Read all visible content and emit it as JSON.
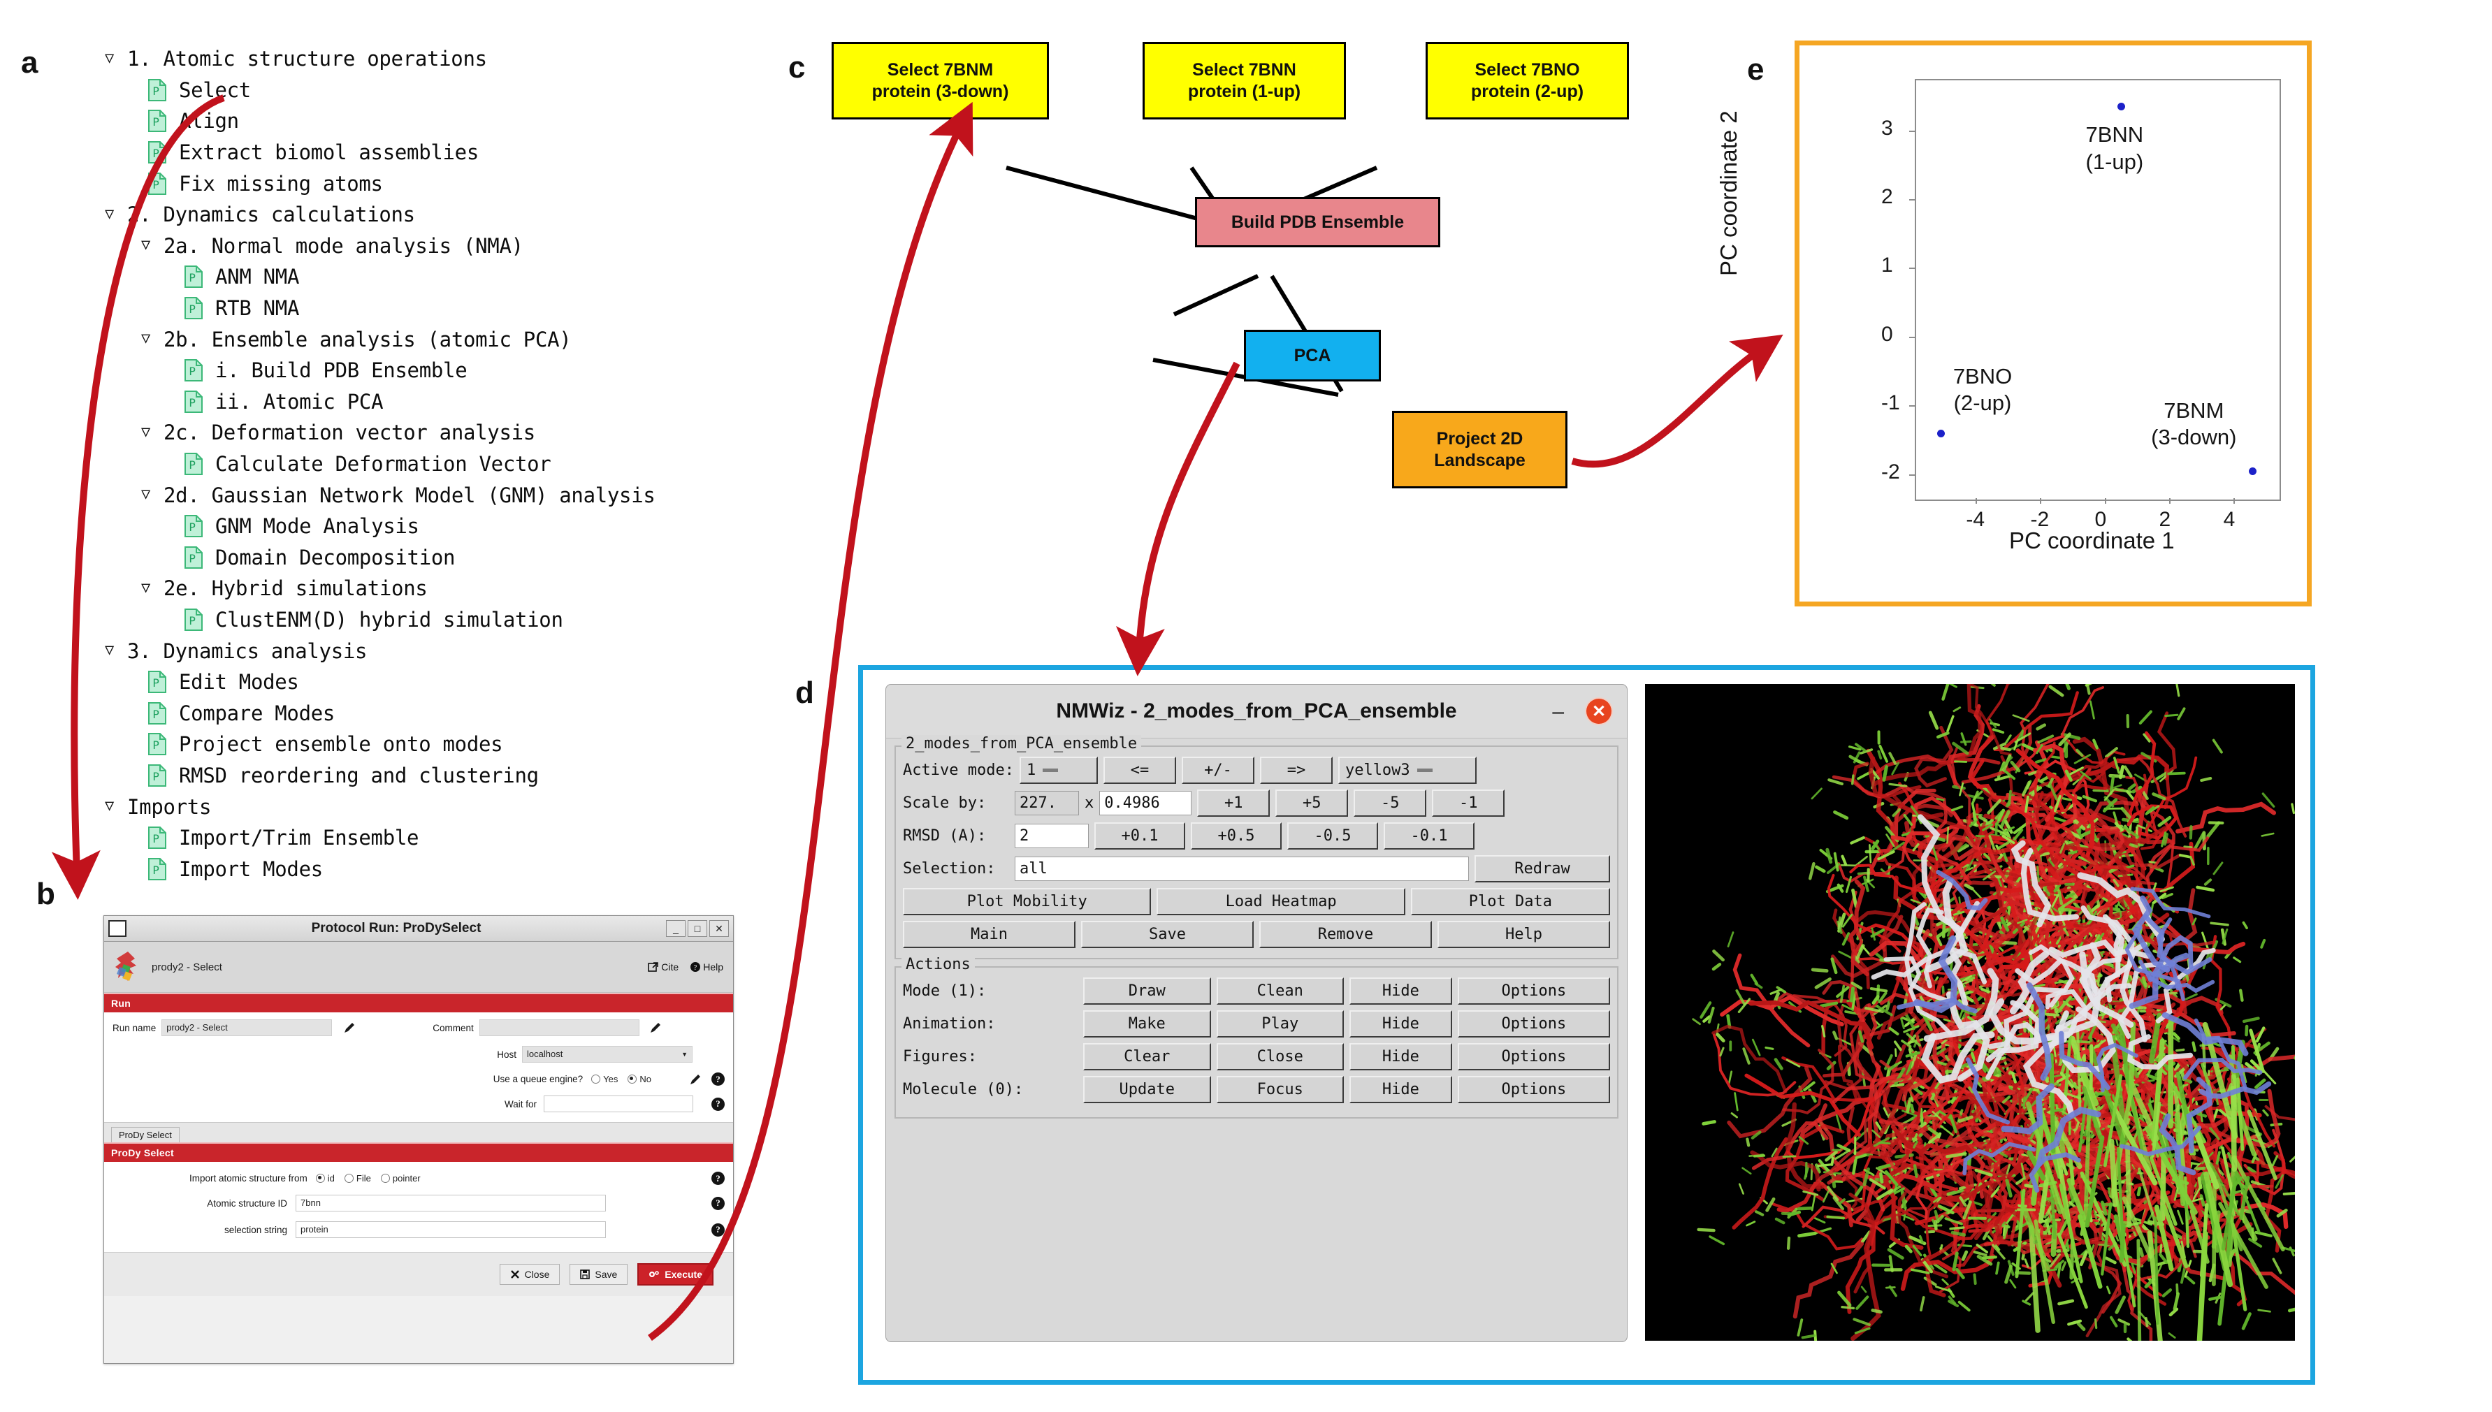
{
  "panels": {
    "a": "a",
    "b": "b",
    "c": "c",
    "d": "d",
    "e": "e"
  },
  "tree": {
    "items": [
      {
        "label": "1. Atomic structure operations",
        "type": "group",
        "indent": 0
      },
      {
        "label": "Select",
        "type": "item",
        "indent": 0
      },
      {
        "label": "Align",
        "type": "item",
        "indent": 0
      },
      {
        "label": "Extract biomol assemblies",
        "type": "item",
        "indent": 0
      },
      {
        "label": "Fix missing atoms",
        "type": "item",
        "indent": 0
      },
      {
        "label": "2. Dynamics calculations",
        "type": "group",
        "indent": 0
      },
      {
        "label": "2a. Normal mode analysis (NMA)",
        "type": "group",
        "indent": 1
      },
      {
        "label": "ANM NMA",
        "type": "item",
        "indent": 1
      },
      {
        "label": "RTB NMA",
        "type": "item",
        "indent": 1
      },
      {
        "label": "2b. Ensemble analysis (atomic PCA)",
        "type": "group",
        "indent": 1
      },
      {
        "label": "i. Build PDB Ensemble",
        "type": "item",
        "indent": 1
      },
      {
        "label": "ii. Atomic PCA",
        "type": "item",
        "indent": 1
      },
      {
        "label": "2c. Deformation vector analysis",
        "type": "group",
        "indent": 1
      },
      {
        "label": "Calculate Deformation Vector",
        "type": "item",
        "indent": 1
      },
      {
        "label": "2d. Gaussian Network Model (GNM) analysis",
        "type": "group",
        "indent": 1
      },
      {
        "label": "GNM Mode Analysis",
        "type": "item",
        "indent": 1
      },
      {
        "label": "Domain Decomposition",
        "type": "item",
        "indent": 1
      },
      {
        "label": "2e. Hybrid simulations",
        "type": "group",
        "indent": 1
      },
      {
        "label": "ClustENM(D) hybrid simulation",
        "type": "item",
        "indent": 1
      },
      {
        "label": "3. Dynamics analysis",
        "type": "group",
        "indent": 0
      },
      {
        "label": "Edit Modes",
        "type": "item",
        "indent": 0
      },
      {
        "label": "Compare Modes",
        "type": "item",
        "indent": 0
      },
      {
        "label": "Project ensemble onto modes",
        "type": "item",
        "indent": 0
      },
      {
        "label": "RMSD reordering and clustering",
        "type": "item",
        "indent": 0
      },
      {
        "label": "Imports",
        "type": "group",
        "indent": 0
      },
      {
        "label": "Import/Trim Ensemble",
        "type": "item",
        "indent": 0
      },
      {
        "label": "Import Modes",
        "type": "item",
        "indent": 0
      }
    ]
  },
  "protocol_dialog": {
    "window_title": "Protocol Run: ProDySelect",
    "minimize": "_",
    "maximize": "□",
    "close": "✕",
    "header_title": "prody2 - Select",
    "cite_label": "Cite",
    "help_label": "Help",
    "section_run": "Run",
    "run_name_label": "Run name",
    "run_name_value": "prody2 - Select",
    "comment_label": "Comment",
    "comment_value": "",
    "host_label": "Host",
    "host_value": "localhost",
    "queue_label": "Use a queue engine?",
    "queue_yes": "Yes",
    "queue_no": "No",
    "wait_label": "Wait for",
    "wait_value": "",
    "tab_label": "ProDy Select",
    "section_prody": "ProDy Select",
    "import_label": "Import atomic structure from",
    "import_opt_id": "id",
    "import_opt_file": "File",
    "import_opt_pointer": "pointer",
    "structure_id_label": "Atomic structure ID",
    "structure_id_value": "7bnn",
    "selection_string_label": "selection string",
    "selection_string_value": "protein",
    "btn_close": "Close",
    "btn_save": "Save",
    "btn_execute": "Execute"
  },
  "flow": {
    "nodes": [
      {
        "id": "sel-7bnm",
        "line1": "Select 7BNM",
        "line2": "protein (3-down)",
        "color": "#ffff00"
      },
      {
        "id": "sel-7bnn",
        "line1": "Select 7BNN",
        "line2": "protein (1-up)",
        "color": "#ffff00"
      },
      {
        "id": "sel-7bno",
        "line1": "Select 7BNO",
        "line2": "protein (2-up)",
        "color": "#ffff00"
      },
      {
        "id": "build-pdb-ensemble",
        "line1": "Build PDB Ensemble",
        "line2": "",
        "color": "#e8868c"
      },
      {
        "id": "pca",
        "line1": "PCA",
        "line2": "",
        "color": "#12b0ef"
      },
      {
        "id": "project-2d",
        "line1": "Project 2D",
        "line2": "Landscape",
        "color": "#f8a81b"
      }
    ]
  },
  "nmwiz": {
    "title": "NMWiz - 2_modes_from_PCA_ensemble",
    "minimize": "–",
    "close": "✕",
    "group_legend": "2_modes_from_PCA_ensemble",
    "active_mode_label": "Active mode:",
    "active_mode_value": "1",
    "btn_prev": "<=",
    "btn_plusminus": "+/-",
    "btn_next": "=>",
    "color_value": "yellow3",
    "scale_label": "Scale by:",
    "scale_value": "227.",
    "scale_times": "x",
    "scale_factor": "0.4986",
    "scale_p1": "+1",
    "scale_p5": "+5",
    "scale_m5": "-5",
    "scale_m1": "-1",
    "rmsd_label": "RMSD (A):",
    "rmsd_value": "2",
    "rmsd_p01": "+0.1",
    "rmsd_p05": "+0.5",
    "rmsd_m05": "-0.5",
    "rmsd_m01": "-0.1",
    "selection_label": "Selection:",
    "selection_value": "all",
    "btn_redraw": "Redraw",
    "btn_plot_mobility": "Plot Mobility",
    "btn_load_heatmap": "Load Heatmap",
    "btn_plot_data": "Plot Data",
    "btn_main": "Main",
    "btn_save": "Save",
    "btn_remove": "Remove",
    "btn_help": "Help",
    "actions_legend": "Actions",
    "actions": [
      {
        "label": "Mode (1):",
        "b1": "Draw",
        "b2": "Clean",
        "b3": "Hide",
        "b4": "Options"
      },
      {
        "label": "Animation:",
        "b1": "Make",
        "b2": "Play",
        "b3": "Hide",
        "b4": "Options"
      },
      {
        "label": "Figures:",
        "b1": "Clear",
        "b2": "Close",
        "b3": "Hide",
        "b4": "Options"
      },
      {
        "label": "Molecule (0):",
        "b1": "Update",
        "b2": "Focus",
        "b3": "Hide",
        "b4": "Options"
      }
    ]
  },
  "chart_data": {
    "type": "scatter",
    "title": "",
    "xlabel": "PC coordinate 1",
    "ylabel": "PC coordinate 2",
    "xlim": [
      -5.9,
      5.4
    ],
    "ylim": [
      -2.35,
      3.75
    ],
    "xticks": [
      -4,
      -2,
      0,
      2,
      4
    ],
    "yticks": [
      -2,
      -1,
      0,
      1,
      2,
      3
    ],
    "grid": false,
    "legend": "none",
    "point_color": "#1c21c9",
    "points": [
      {
        "label": "7BNN",
        "sublabel": "(1-up)",
        "x": 0.5,
        "y": 3.35
      },
      {
        "label": "7BNO",
        "sublabel": "(2-up)",
        "x": -5.1,
        "y": -1.4
      },
      {
        "label": "7BNM",
        "sublabel": "(3-down)",
        "x": 4.6,
        "y": -1.95
      }
    ]
  },
  "colors": {
    "panel_d_border": "#1ca5e0",
    "panel_e_border": "#f5a623",
    "arrow_red": "#c1121c",
    "execute_red": "#cc2229"
  }
}
